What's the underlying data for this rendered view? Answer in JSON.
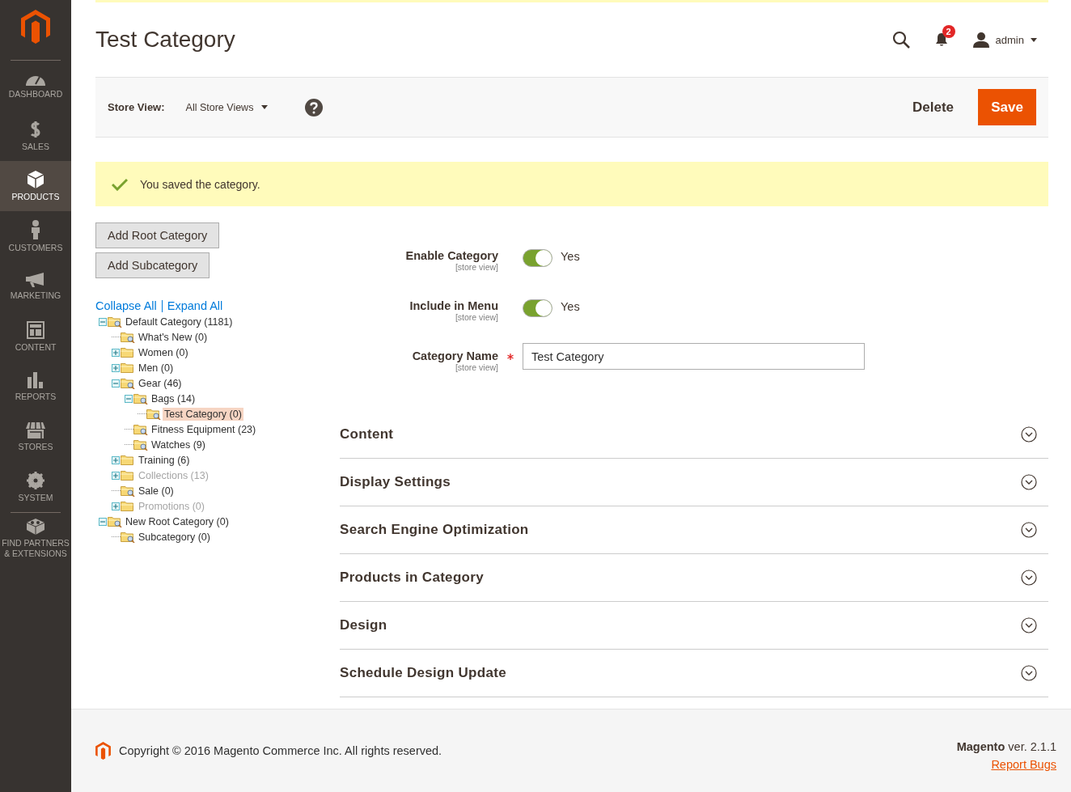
{
  "sidebar": {
    "items": [
      {
        "kind": "dashboard",
        "label": "DASHBOARD",
        "selected": false
      },
      {
        "kind": "sales",
        "label": "SALES",
        "selected": false
      },
      {
        "kind": "products",
        "label": "PRODUCTS",
        "selected": true
      },
      {
        "kind": "customers",
        "label": "CUSTOMERS",
        "selected": false
      },
      {
        "kind": "marketing",
        "label": "MARKETING",
        "selected": false
      },
      {
        "kind": "content",
        "label": "CONTENT",
        "selected": false
      },
      {
        "kind": "reports",
        "label": "REPORTS",
        "selected": false
      },
      {
        "kind": "stores",
        "label": "STORES",
        "selected": false
      },
      {
        "kind": "system",
        "label": "SYSTEM",
        "selected": false
      },
      {
        "kind": "partners",
        "label": "FIND PARTNERS & EXTENSIONS",
        "selected": false
      }
    ]
  },
  "header": {
    "title": "Test Category",
    "notifications": "2",
    "user": "admin"
  },
  "toolbar": {
    "store_view_label": "Store View:",
    "store_view": "All Store Views",
    "buttons": [
      {
        "kind": "secondary",
        "label": "Delete"
      },
      {
        "kind": "primary",
        "label": "Save"
      }
    ]
  },
  "message": "You saved the category.",
  "tree_buttons": [
    "Add Root Category",
    "Add Subcategory"
  ],
  "tree_links": [
    "Collapse All",
    "Expand All"
  ],
  "tree": [
    {
      "label": "Default Category (1181)",
      "kind": "branch",
      "expanded": true,
      "disabled": false,
      "selected": false,
      "children": [
        {
          "label": "What's New (0)",
          "kind": "leaf",
          "disabled": false,
          "selected": false
        },
        {
          "label": "Women (0)",
          "kind": "branch",
          "expanded": false,
          "disabled": false,
          "selected": false
        },
        {
          "label": "Men (0)",
          "kind": "branch",
          "expanded": false,
          "disabled": false,
          "selected": false
        },
        {
          "label": "Gear (46)",
          "kind": "branch",
          "expanded": true,
          "disabled": false,
          "selected": false,
          "children": [
            {
              "label": "Bags (14)",
              "kind": "branch",
              "expanded": true,
              "disabled": false,
              "selected": false,
              "children": [
                {
                  "label": "Test Category (0)",
                  "kind": "leaf",
                  "disabled": false,
                  "selected": true
                }
              ]
            },
            {
              "label": "Fitness Equipment (23)",
              "kind": "leaf",
              "disabled": false,
              "selected": false
            },
            {
              "label": "Watches (9)",
              "kind": "leaf",
              "disabled": false,
              "selected": false
            }
          ]
        },
        {
          "label": "Training (6)",
          "kind": "branch",
          "expanded": false,
          "disabled": false,
          "selected": false
        },
        {
          "label": "Collections (13)",
          "kind": "branch",
          "expanded": false,
          "disabled": true,
          "selected": false
        },
        {
          "label": "Sale (0)",
          "kind": "leaf",
          "disabled": false,
          "selected": false
        },
        {
          "label": "Promotions (0)",
          "kind": "branch",
          "expanded": false,
          "disabled": true,
          "selected": false
        }
      ]
    },
    {
      "label": "New Root Category (0)",
      "kind": "branch",
      "expanded": true,
      "disabled": false,
      "selected": false,
      "children": [
        {
          "label": "Subcategory (0)",
          "kind": "leaf",
          "disabled": false,
          "selected": false
        }
      ]
    }
  ],
  "form": [
    {
      "kind": "toggle",
      "label": "Enable Category",
      "scope": "[store view]",
      "on": true,
      "value": "Yes"
    },
    {
      "kind": "toggle",
      "label": "Include in Menu",
      "scope": "[store view]",
      "on": true,
      "value": "Yes"
    },
    {
      "kind": "text",
      "label": "Category Name",
      "scope": "[store view]",
      "required": true,
      "value": "Test Category"
    }
  ],
  "sections": [
    {
      "title": "Content",
      "expanded": false
    },
    {
      "title": "Display Settings",
      "expanded": false
    },
    {
      "title": "Search Engine Optimization",
      "expanded": false
    },
    {
      "title": "Products in Category",
      "expanded": false
    },
    {
      "title": "Design",
      "expanded": false
    },
    {
      "title": "Schedule Design Update",
      "expanded": false
    }
  ],
  "footer": {
    "copyright": "Copyright © 2016 Magento Commerce Inc. All rights reserved.",
    "version": "**Magento** ver. 2.1.1",
    "link": "Report Bugs"
  }
}
